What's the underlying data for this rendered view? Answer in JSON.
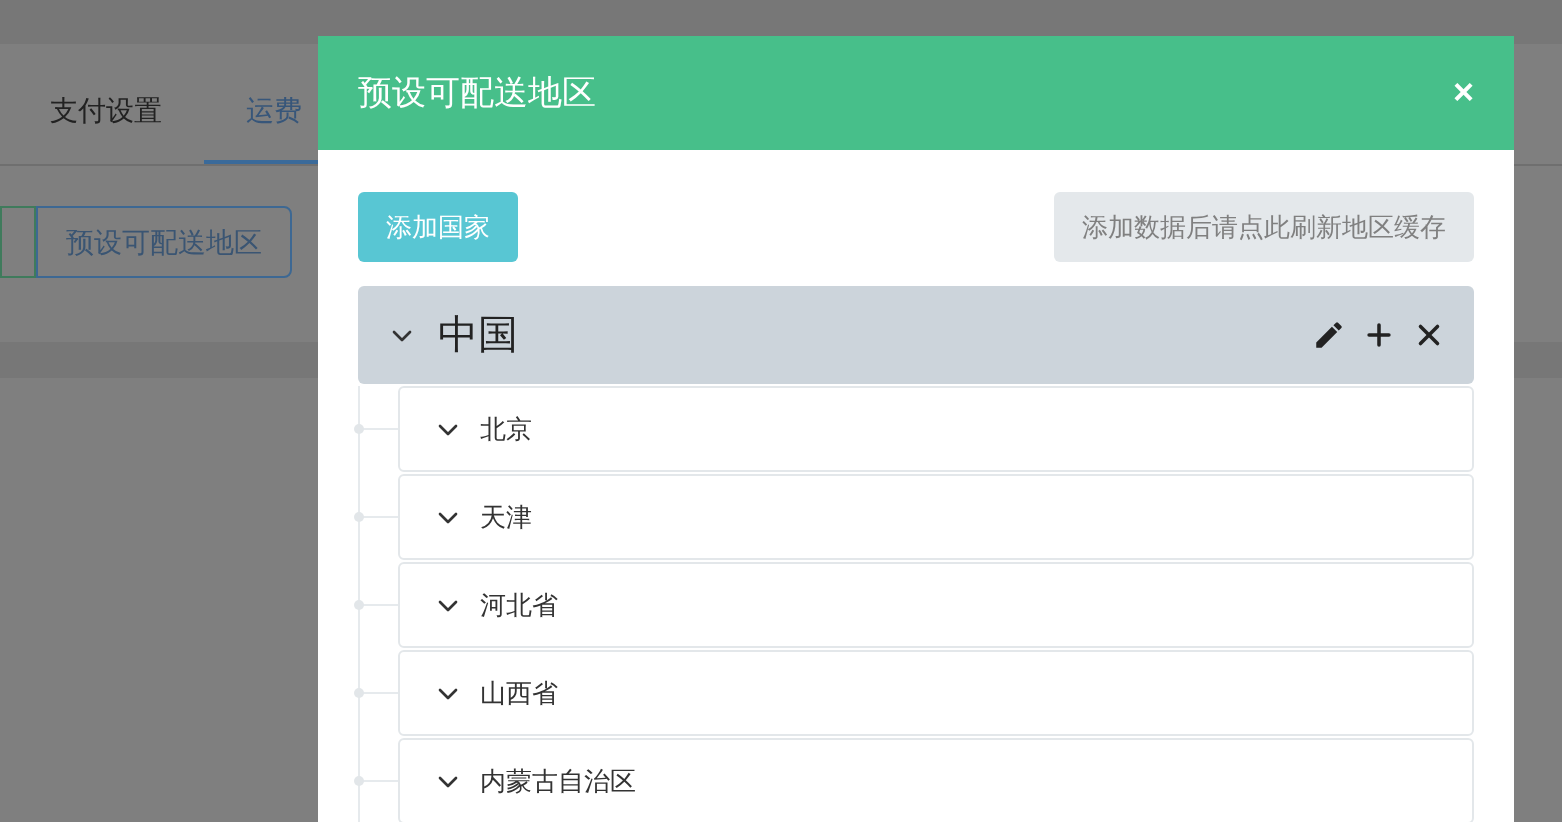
{
  "background": {
    "tabs": [
      {
        "label": "支付设置",
        "selected": false
      },
      {
        "label": "运费",
        "selected": true
      }
    ],
    "button": "预设可配送地区"
  },
  "modal": {
    "title": "预设可配送地区",
    "close": "×",
    "add_button": "添加国家",
    "refresh_button": "添加数据后请点此刷新地区缓存",
    "tree": [
      {
        "label": "中国",
        "expanded": true,
        "children": [
          {
            "label": "北京"
          },
          {
            "label": "天津"
          },
          {
            "label": "河北省"
          },
          {
            "label": "山西省"
          },
          {
            "label": "内蒙古自治区"
          }
        ]
      }
    ]
  }
}
